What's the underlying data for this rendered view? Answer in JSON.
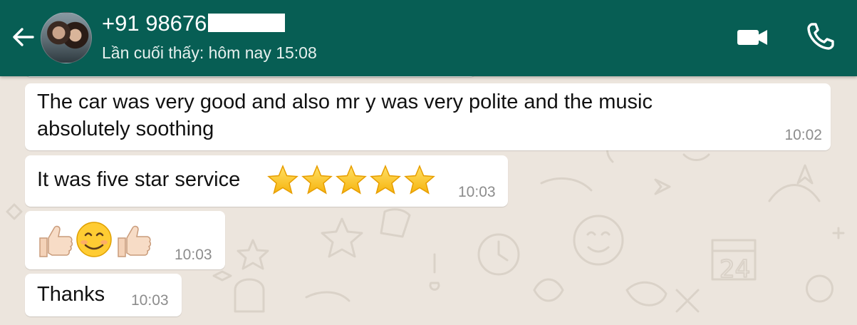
{
  "header": {
    "contact_name": "+91 98676",
    "last_seen": "Lần cuối thấy: hôm nay 15:08",
    "back_icon": "arrow-left-icon",
    "video_icon": "videocam-icon",
    "call_icon": "phone-icon"
  },
  "messages": [
    {
      "text": "The car was very good and also mr y was very polite and the music absolutely soothing",
      "time": "10:02"
    },
    {
      "text": "It was five star service",
      "emoji": "star-icon x5",
      "time": "10:03"
    },
    {
      "emoji": "thumbs-up, smiling-face, thumbs-up",
      "time": "10:03"
    },
    {
      "text": "Thanks",
      "time": "10:03"
    }
  ],
  "colors": {
    "header_bg": "#075e54",
    "chat_bg": "#ece5dd",
    "bubble_bg": "#ffffff",
    "time_text": "#8c8c8c"
  }
}
